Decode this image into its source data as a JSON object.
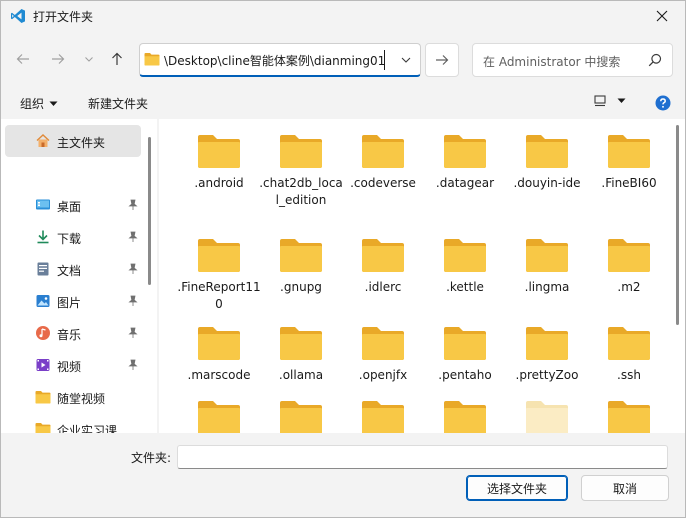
{
  "window": {
    "title": "打开文件夹",
    "colors": {
      "accent": "#005fb8",
      "folder": "#f8c846",
      "folder_dark": "#e9a928",
      "vscode_blue": "#1f8ad2"
    }
  },
  "address": {
    "path": "\\Desktop\\cline智能体案例\\dianming01"
  },
  "search": {
    "placeholder": "在 Administrator 中搜索"
  },
  "toolbar": {
    "organize_label": "组织",
    "new_folder_label": "新建文件夹"
  },
  "sidebar": {
    "home": {
      "label": "主文件夹",
      "icon": "home-icon"
    },
    "items": [
      {
        "label": "桌面",
        "icon": "desktop-icon",
        "pinned": true
      },
      {
        "label": "下载",
        "icon": "download-icon",
        "pinned": true
      },
      {
        "label": "文档",
        "icon": "document-icon",
        "pinned": true
      },
      {
        "label": "图片",
        "icon": "picture-icon",
        "pinned": true
      },
      {
        "label": "音乐",
        "icon": "music-icon",
        "pinned": true
      },
      {
        "label": "视频",
        "icon": "video-icon",
        "pinned": true
      },
      {
        "label": "随堂视频",
        "icon": "folder-icon",
        "pinned": false
      },
      {
        "label": "企业实习课",
        "icon": "folder-icon",
        "pinned": false
      }
    ]
  },
  "files": [
    {
      "name": ".android"
    },
    {
      "name": ".chat2db_local_edition"
    },
    {
      "name": ".codeverse"
    },
    {
      "name": ".datagear"
    },
    {
      "name": ".douyin-ide"
    },
    {
      "name": ".FineBI60"
    },
    {
      "name": ".FineReport110"
    },
    {
      "name": ".gnupg"
    },
    {
      "name": ".idlerc"
    },
    {
      "name": ".kettle"
    },
    {
      "name": ".lingma"
    },
    {
      "name": ".m2"
    },
    {
      "name": ".marscode"
    },
    {
      "name": ".ollama"
    },
    {
      "name": ".openjfx"
    },
    {
      "name": ".pentaho"
    },
    {
      "name": ".prettyZoo"
    },
    {
      "name": ".ssh"
    },
    {
      "name": ""
    },
    {
      "name": ""
    },
    {
      "name": ""
    },
    {
      "name": ""
    },
    {
      "name": ""
    },
    {
      "name": ""
    }
  ],
  "bottom": {
    "folder_label": "文件夹:",
    "folder_value": "",
    "select_button": "选择文件夹",
    "cancel_button": "取消"
  }
}
